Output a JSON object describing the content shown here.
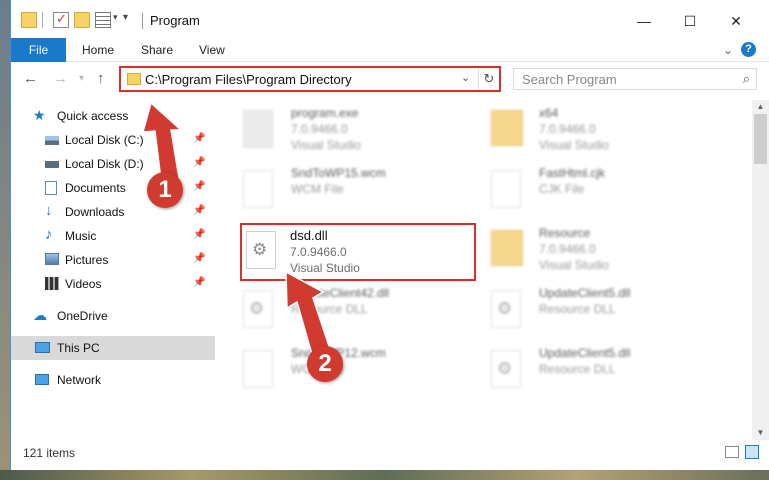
{
  "window": {
    "title": "Program"
  },
  "title_controls": {
    "minimize": "—",
    "maximize": "☐",
    "close": "✕"
  },
  "ribbon": {
    "tabs": [
      "File",
      "Home",
      "Share",
      "View"
    ]
  },
  "address": {
    "path": "C:\\Program Files\\Program Directory"
  },
  "search": {
    "placeholder": "Search Program"
  },
  "sidebar": {
    "items": [
      {
        "label": "Quick access",
        "icon": "star-icon"
      },
      {
        "label": "Local Disk (C:)",
        "icon": "drive-icon",
        "pinned": true
      },
      {
        "label": "Local Disk (D:)",
        "icon": "drive-icon",
        "pinned": true
      },
      {
        "label": "Documents",
        "icon": "documents-icon",
        "pinned": true
      },
      {
        "label": "Downloads",
        "icon": "downloads-icon",
        "pinned": true
      },
      {
        "label": "Music",
        "icon": "music-icon",
        "pinned": true
      },
      {
        "label": "Pictures",
        "icon": "pictures-icon",
        "pinned": true
      },
      {
        "label": "Videos",
        "icon": "videos-icon",
        "pinned": true
      },
      {
        "label": "OneDrive",
        "icon": "cloud-icon"
      },
      {
        "label": "This PC",
        "icon": "computer-icon",
        "selected": true
      },
      {
        "label": "Network",
        "icon": "network-icon"
      }
    ]
  },
  "files": [
    {
      "name": "program.exe",
      "line2": "7.0.9466.0",
      "line3": "Visual Studio",
      "icon": "exe-icon"
    },
    {
      "name": "x64",
      "line2": "7.0.9466.0",
      "line3": "Visual Studio",
      "icon": "folder-icon"
    },
    {
      "name": "SndToWP15.wcm",
      "line2": "WCM File",
      "line3": "",
      "icon": "file-icon"
    },
    {
      "name": "FastHtml.cjk",
      "line2": "CJK File",
      "line3": "",
      "icon": "file-icon"
    },
    {
      "name": "dsd.dll",
      "line2": "7.0.9466.0",
      "line3": "Visual Studio",
      "icon": "gear-file-icon"
    },
    {
      "name": "Resource",
      "line2": "7.0.9466.0",
      "line3": "Visual Studio",
      "icon": "folder-icon"
    },
    {
      "name": "UpdateClient42.dll",
      "line2": "Resource DLL",
      "line3": "",
      "icon": "gear-file-icon"
    },
    {
      "name": "UpdateClient5.dll",
      "line2": "Resource DLL",
      "line3": "",
      "icon": "gear-file-icon"
    },
    {
      "name": "SndToWP12.wcm",
      "line2": "WCM File",
      "line3": "",
      "icon": "file-icon"
    },
    {
      "name": "UpdateClient5.dll",
      "line2": "Resource DLL",
      "line3": "",
      "icon": "gear-file-icon"
    }
  ],
  "status": {
    "count": "121 items"
  },
  "annotations": {
    "step1": "1",
    "step2": "2",
    "color": "#d03a2f"
  }
}
